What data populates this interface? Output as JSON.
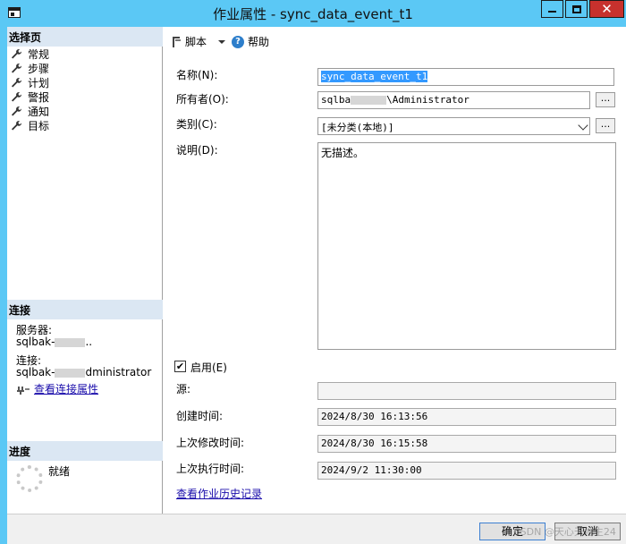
{
  "window": {
    "title": "作业属性 - sync_data_event_t1",
    "close_glyph": "✕"
  },
  "left_panel": {
    "select_page_header": "选择页",
    "pages": [
      {
        "label": "常规",
        "icon": "wrench-icon"
      },
      {
        "label": "步骤",
        "icon": "wrench-icon"
      },
      {
        "label": "计划",
        "icon": "wrench-icon"
      },
      {
        "label": "警报",
        "icon": "wrench-icon"
      },
      {
        "label": "通知",
        "icon": "wrench-icon"
      },
      {
        "label": "目标",
        "icon": "wrench-icon"
      }
    ],
    "connection_header": "连接",
    "server_label": "服务器:",
    "server_value": "sqlbak-",
    "server_value_suffix": "..",
    "connection_label": "连接:",
    "connection_value": "sqlbak-",
    "connection_value_suffix": "dministrator",
    "view_connection_properties": "查看连接属性",
    "progress_header": "进度",
    "progress_status": "就绪"
  },
  "toolbar": {
    "script_label": "脚本",
    "help_label": "帮助"
  },
  "form": {
    "name_label": "名称(N):",
    "name_value": "sync_data_event_t1",
    "owner_label": "所有者(O):",
    "owner_value_prefix": "sqlba",
    "owner_value_suffix": "\\Administrator",
    "category_label": "类别(C):",
    "category_value": "[未分类(本地)]",
    "description_label": "说明(D):",
    "description_value": "无描述。",
    "browse_button": "...",
    "enabled_label": "启用(E)",
    "enabled_checked": true,
    "source_label": "源:",
    "source_value": "",
    "created_label": "创建时间:",
    "created_value": "2024/8/30 16:13:56",
    "modified_label": "上次修改时间:",
    "modified_value": "2024/8/30 16:15:58",
    "executed_label": "上次执行时间:",
    "executed_value": "2024/9/2 11:30:00",
    "history_link": "查看作业历史记录"
  },
  "buttons": {
    "ok": "确定",
    "cancel": "取消"
  },
  "watermark": "CSDN @天心天地生24",
  "colors": {
    "titlebar": "#5bc8f5",
    "close_button": "#c7312d",
    "section_header": "#dbe7f3",
    "selection": "#3399ff",
    "link": "#1a0dab"
  }
}
